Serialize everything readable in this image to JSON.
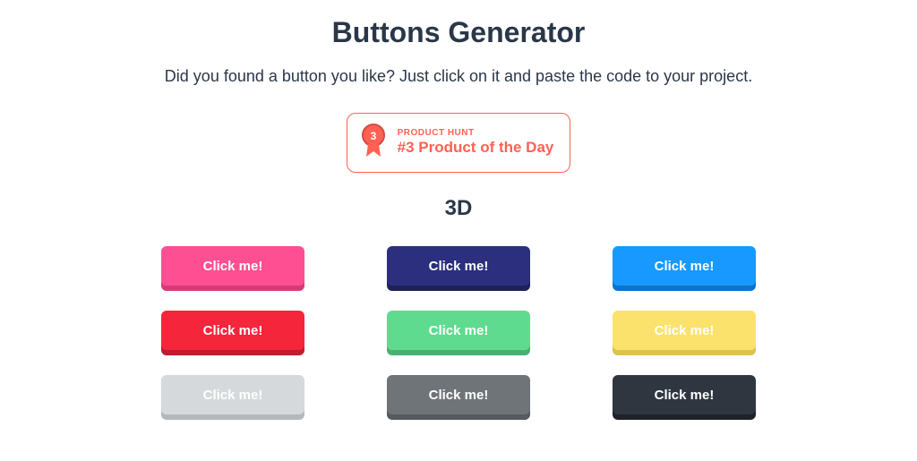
{
  "title": "Buttons Generator",
  "subtitle": "Did you found a button you like? Just click on it and paste the code to your project.",
  "badge": {
    "top": "PRODUCT HUNT",
    "bottom": "#3 Product of the Day",
    "rank": "3"
  },
  "section_title": "3D",
  "button_label": "Click me!",
  "buttons": [
    {
      "color": "#ff4f93",
      "shadow": "#d63b76"
    },
    {
      "color": "#2b2f7e",
      "shadow": "#1f2259"
    },
    {
      "color": "#1899ff",
      "shadow": "#0f74c7"
    },
    {
      "color": "#f5253b",
      "shadow": "#c01b2e"
    },
    {
      "color": "#5fdb8f",
      "shadow": "#45b271"
    },
    {
      "color": "#fbe26c",
      "shadow": "#dcc24f"
    },
    {
      "color": "#d5d9dc",
      "shadow": "#b4b8bb"
    },
    {
      "color": "#6f7479",
      "shadow": "#545a5e"
    },
    {
      "color": "#2f3640",
      "shadow": "#1e232a"
    }
  ]
}
